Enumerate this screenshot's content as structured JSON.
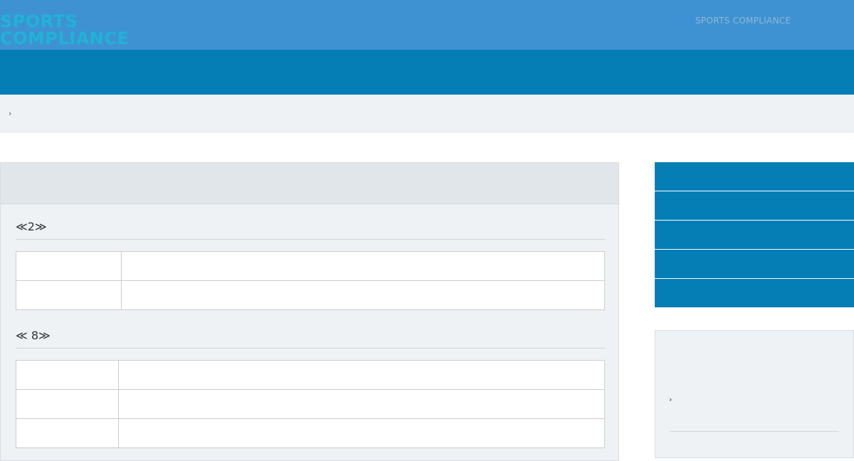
{
  "header": {
    "brand": "SPORTS\nCOMPLIANCE",
    "brand_color": "#1fb3d8",
    "nav_link": "SPORTS COMPLIANCE",
    "nav_link_color": "#8fb7d8",
    "top_bg": "#3f92d2",
    "band_bg": "#057eb6"
  },
  "breadcrumb": {
    "separator": "›"
  },
  "main": {
    "sections": [
      {
        "title": "≪2≫",
        "rows": [
          {
            "label": "",
            "value": ""
          },
          {
            "label": "",
            "value": ""
          }
        ]
      },
      {
        "title": "≪ 8≫",
        "rows": [
          {
            "label": "",
            "value": ""
          },
          {
            "label": "",
            "value": ""
          },
          {
            "label": "",
            "value": ""
          }
        ]
      }
    ]
  },
  "sidebar": {
    "menu_items": [
      "",
      "",
      "",
      "",
      ""
    ],
    "box": {
      "arrow": "›"
    }
  }
}
